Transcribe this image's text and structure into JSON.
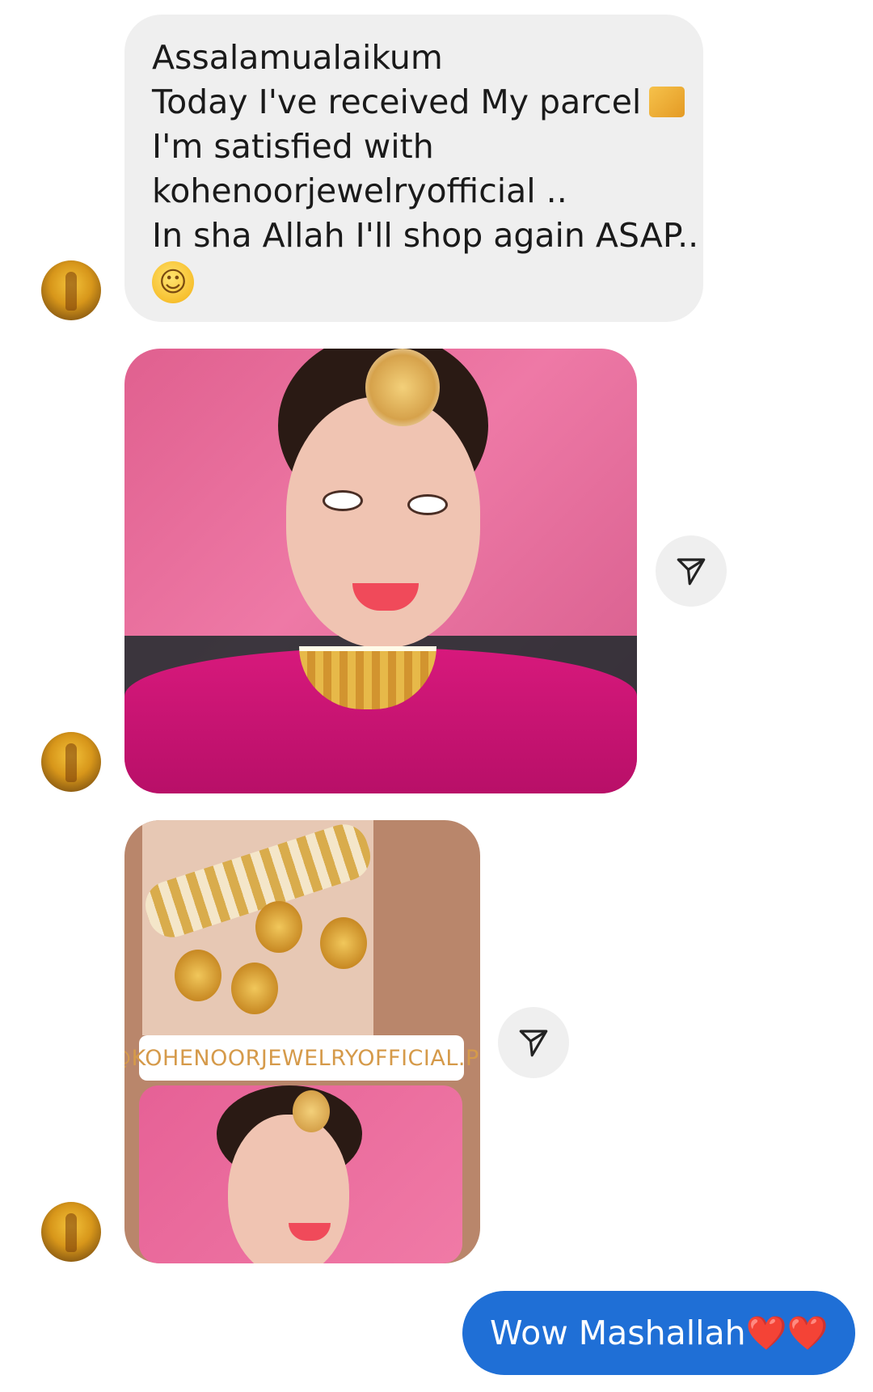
{
  "conversation": {
    "incoming_text": {
      "lines": [
        "Assalamualaikum",
        "Today I've received My parcel",
        "I'm satisfied with",
        "kohenoorjewelryofficial ..",
        "In sha Allah I'll shop again ASAP.."
      ],
      "box_emoji": "📦",
      "smile_emoji": "☺"
    },
    "photo_tag": "@KOHENOORJEWELRYOFFICIAL.PK",
    "outgoing_text": "Wow Mashallah",
    "outgoing_emoji": "❤️❤️"
  },
  "icons": {
    "share": "send-paper-plane-icon",
    "avatar": "profile-avatar-icon"
  },
  "colors": {
    "incoming_bubble": "#efefef",
    "outgoing_bubble": "#1f6fd6",
    "tag_text": "#d59a4a"
  }
}
